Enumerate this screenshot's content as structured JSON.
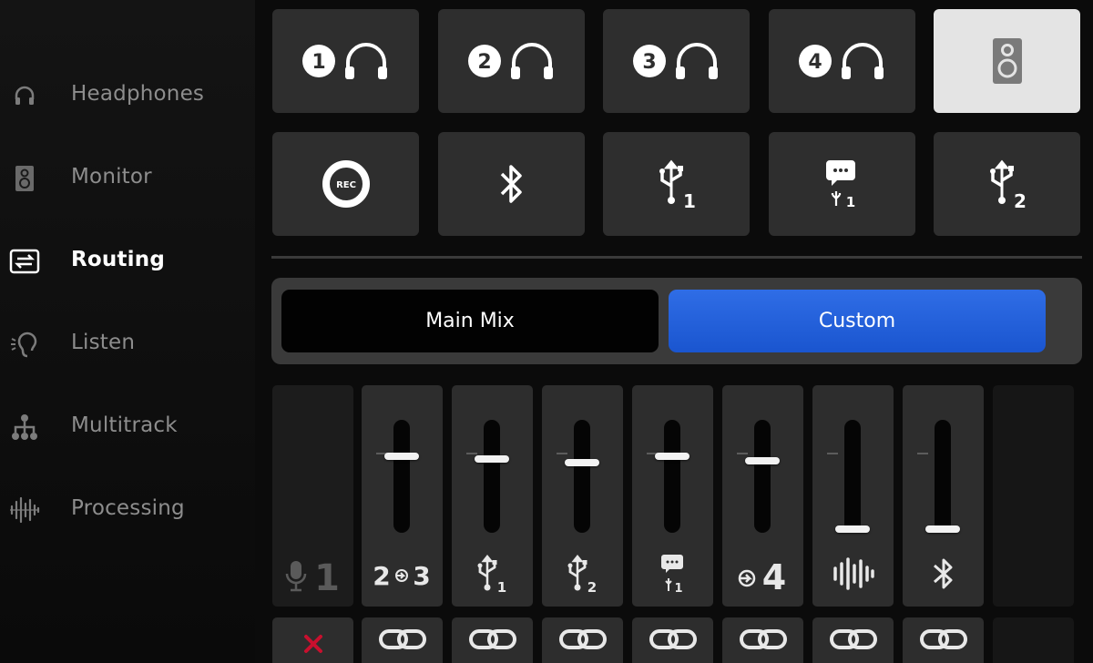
{
  "sidebar": {
    "items": [
      {
        "label": "Headphones",
        "icon": "headphones-icon"
      },
      {
        "label": "Monitor",
        "icon": "speaker-icon"
      },
      {
        "label": "Routing",
        "icon": "routing-icon",
        "active": true
      },
      {
        "label": "Listen",
        "icon": "ear-icon"
      },
      {
        "label": "Multitrack",
        "icon": "hierarchy-icon"
      },
      {
        "label": "Processing",
        "icon": "waveform-icon"
      }
    ]
  },
  "outputs": {
    "headphones": [
      "1",
      "2",
      "3",
      "4"
    ],
    "selected": "monitor-speaker"
  },
  "sources": {
    "rec_label": "REC",
    "usb1_num": "1",
    "chat_num": "1",
    "usb2_num": "2"
  },
  "mode": {
    "main_label": "Main Mix",
    "custom_label": "Custom",
    "active": "Custom"
  },
  "mixer": {
    "strips": [
      {
        "id": "mic-1",
        "label": "1",
        "level": null,
        "enabled": false
      },
      {
        "id": "mics-2-3",
        "label_a": "2",
        "label_b": "3",
        "level": 0.69
      },
      {
        "id": "usb-1",
        "sub": "1",
        "level": 0.66
      },
      {
        "id": "usb-2",
        "sub": "2",
        "level": 0.63
      },
      {
        "id": "usb-chat-1",
        "sub": "1",
        "level": 0.69
      },
      {
        "id": "input-4",
        "label": "4",
        "level": 0.65
      },
      {
        "id": "waveform-playback",
        "level": 0.0
      },
      {
        "id": "bluetooth",
        "level": 0.0
      }
    ]
  },
  "colors": {
    "accent": "#1f5fdb",
    "tile": "#2e2e2e",
    "tile_selected": "#e4e4e4",
    "unlinked": "#c8102e"
  }
}
